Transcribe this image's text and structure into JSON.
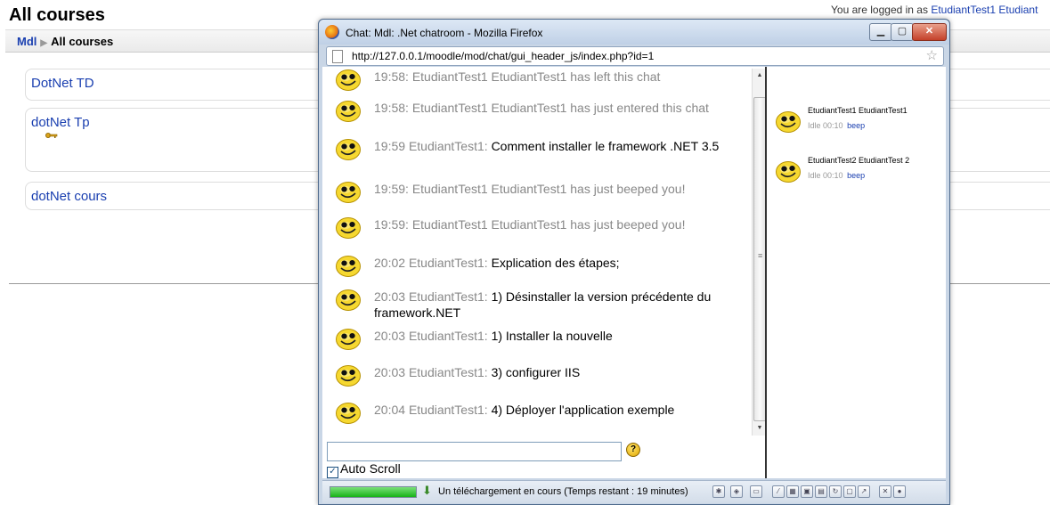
{
  "background_page": {
    "title": "All courses",
    "logged_in_text": "You are logged in as",
    "logged_in_user": "EtudiantTest1 Etudiant",
    "breadcrumb": {
      "home": "Mdl",
      "separator": "▶",
      "current": "All courses"
    },
    "courses": [
      {
        "name": "DotNet TD"
      },
      {
        "name": "dotNet Tp",
        "has_key_icon": true
      },
      {
        "name": "dotNet cours"
      }
    ]
  },
  "popup": {
    "window_title": "Chat: Mdl: .Net chatroom - Mozilla Firefox",
    "url": "http://127.0.0.1/moodle/mod/chat/gui_header_js/index.php?id=1",
    "messages": [
      {
        "time": "19:58:",
        "text": "EtudiantTest1 EtudiantTest1 has left this chat",
        "system": true
      },
      {
        "time": "19:58:",
        "text": "EtudiantTest1 EtudiantTest1 has just entered this chat",
        "system": true
      },
      {
        "time": "19:59",
        "author": "EtudiantTest1:",
        "text": "Comment installer le framework .NET 3.5",
        "system": false
      },
      {
        "time": "19:59:",
        "text": "EtudiantTest1 EtudiantTest1 has just beeped you!",
        "system": true
      },
      {
        "time": "19:59:",
        "text": "EtudiantTest1 EtudiantTest1 has just beeped you!",
        "system": true
      },
      {
        "time": "20:02",
        "author": "EtudiantTest1:",
        "text": "Explication des étapes;",
        "system": false
      },
      {
        "time": "20:03",
        "author": "EtudiantTest1:",
        "text": "1) Désinstaller la version précédente du framework.NET",
        "system": false
      },
      {
        "time": "20:03",
        "author": "EtudiantTest1:",
        "text": "1) Installer la nouvelle",
        "system": false
      },
      {
        "time": "20:03",
        "author": "EtudiantTest1:",
        "text": "3) configurer IIS",
        "system": false
      },
      {
        "time": "20:04",
        "author": "EtudiantTest1:",
        "text": "4) Déployer l'application exemple",
        "system": false
      }
    ],
    "users": [
      {
        "name": "EtudiantTest1 EtudiantTest1",
        "idle": "Idle 00:10",
        "beep": "beep"
      },
      {
        "name": "EtudiantTest2 EtudiantTest 2",
        "idle": "Idle 00:10",
        "beep": "beep"
      }
    ],
    "input": {
      "value": ""
    },
    "auto_scroll": {
      "label": "Auto Scroll",
      "checked": true
    },
    "status": {
      "download_text": "Un téléchargement en cours (Temps restant : 19 minutes)",
      "progress": 1.0
    },
    "icons": {
      "help": "help-icon",
      "star": "bookmark-star-icon",
      "smiley": "smiley-icon"
    }
  }
}
